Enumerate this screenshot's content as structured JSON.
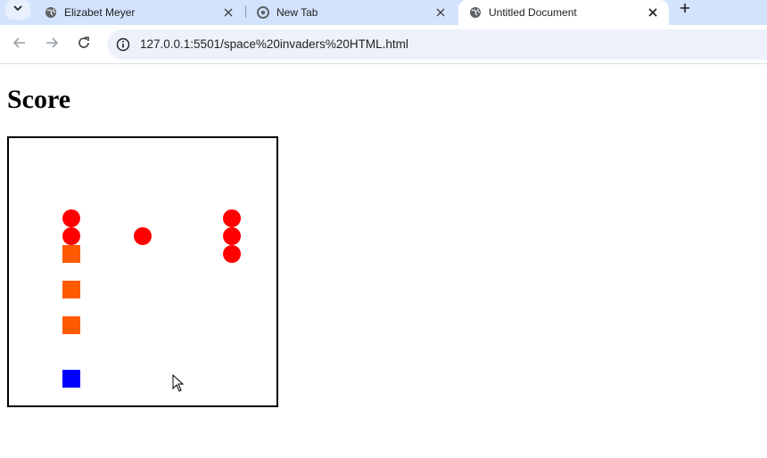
{
  "browser": {
    "tabs": [
      {
        "title": "Elizabet Meyer",
        "active": false
      },
      {
        "title": "New Tab",
        "active": false
      },
      {
        "title": "Untitled Document",
        "active": true
      }
    ],
    "address_bar": {
      "url": "127.0.0.1:5501/space%20invaders%20HTML.html"
    },
    "icons": {
      "tab_search": "chevron-down-icon",
      "favicon": "globe-icon",
      "new_tab": "plus-icon",
      "back": "back-arrow-icon",
      "forward": "forward-arrow-icon",
      "reload": "reload-icon",
      "site_info": "info-icon"
    }
  },
  "page": {
    "heading": "Score",
    "game": {
      "colors": {
        "invader": "#ff0000",
        "shield": "#ff5a00",
        "player": "#0000ff",
        "border": "#000000"
      },
      "invader_count": 6,
      "shield_count": 3,
      "player_count": 1
    }
  }
}
